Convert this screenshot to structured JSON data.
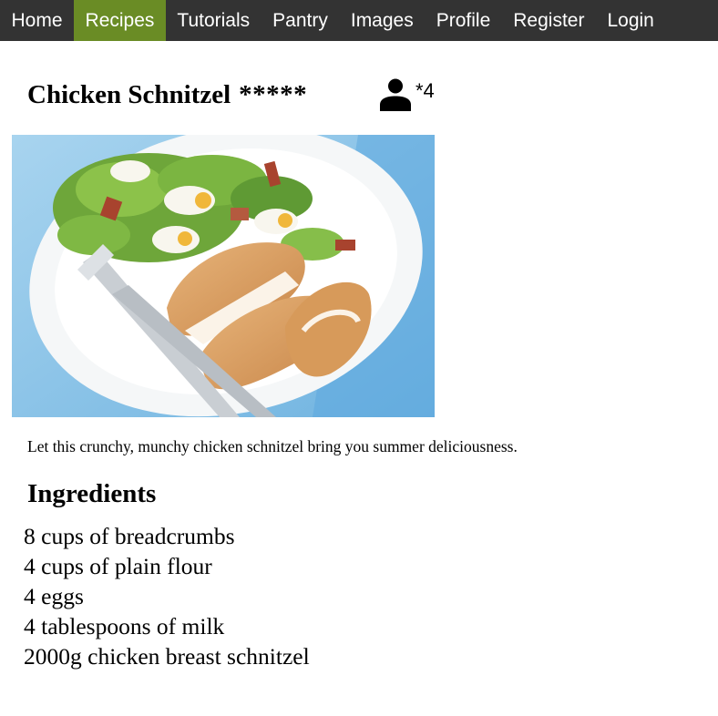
{
  "nav": {
    "items": [
      {
        "label": "Home"
      },
      {
        "label": "Recipes",
        "active": true
      },
      {
        "label": "Tutorials"
      },
      {
        "label": "Pantry"
      },
      {
        "label": "Images"
      },
      {
        "label": "Profile"
      },
      {
        "label": "Register"
      },
      {
        "label": "Login"
      }
    ],
    "background_color": "#333333",
    "active_color": "#6a8c25"
  },
  "recipe": {
    "title": "Chicken Schnitzel",
    "rating_stars": "*****",
    "user_icon": "user-icon",
    "user_count": "*4",
    "image_subject": "photo of chicken schnitzel with salad on white plate",
    "description": "Let this crunchy, munchy chicken schnitzel bring you summer deliciousness.",
    "ingredients_heading": "Ingredients",
    "ingredients": [
      "8 cups of breadcrumbs",
      "4 cups of plain flour",
      "4 eggs",
      "4 tablespoons of milk",
      "2000g chicken breast schnitzel"
    ]
  }
}
